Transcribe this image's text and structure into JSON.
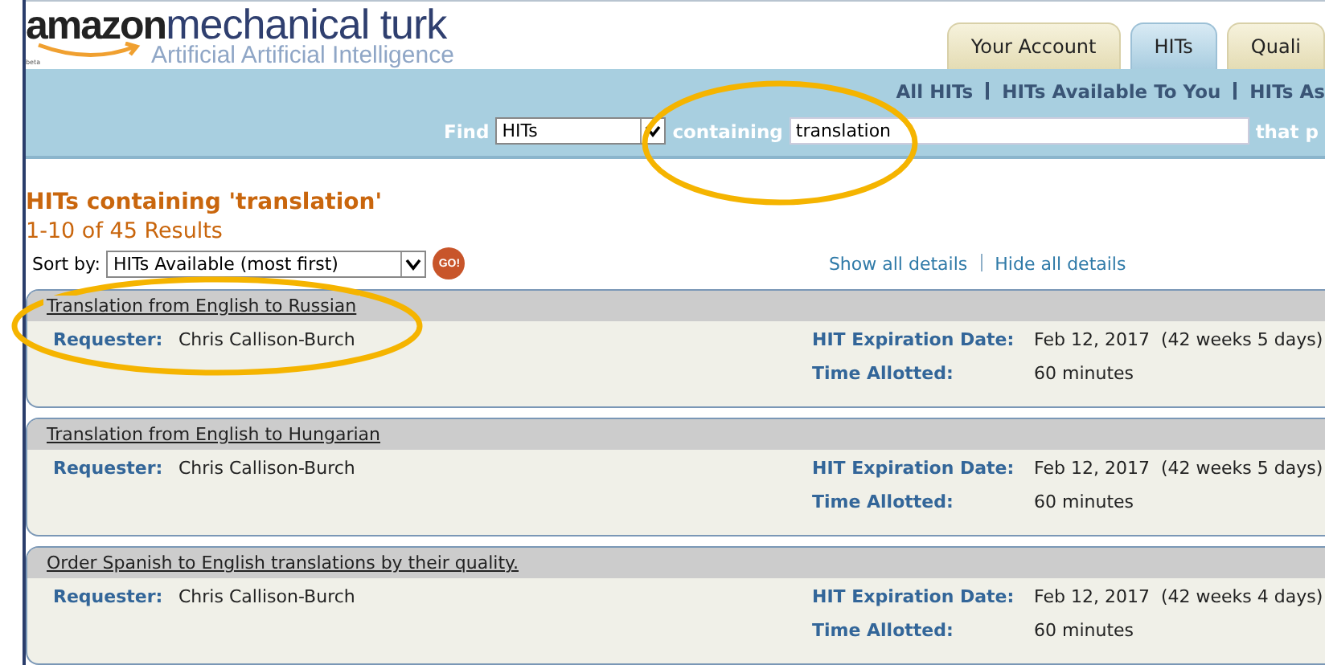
{
  "logo": {
    "brand": "amazon",
    "product": "mechanical turk",
    "tagline": "Artificial Artificial Intelligence",
    "badge": "beta"
  },
  "tabs": [
    {
      "label": "Your Account",
      "selected": false
    },
    {
      "label": "HITs",
      "selected": true
    },
    {
      "label": "Quali",
      "selected": false
    }
  ],
  "nav_links": [
    "All HITs",
    "HITs Available To You",
    "HITs As"
  ],
  "search": {
    "find_label": "Find",
    "type_value": "HITs",
    "containing_label": "containing",
    "query": "translation",
    "trailing_label": "that p"
  },
  "heading": "HITs containing 'translation'",
  "result_count": "1-10 of 45 Results",
  "sort": {
    "label": "Sort by:",
    "value": "HITs Available (most first)",
    "go": "GO!"
  },
  "detail_links": [
    "Show all details",
    "Hide all details"
  ],
  "hits": [
    {
      "title": "Translation from English to Russian",
      "requester_label": "Requester:",
      "requester": "Chris Callison-Burch",
      "expiration_label": "HIT Expiration Date:",
      "expiration": "Feb 12, 2017  (42 weeks 5 days)",
      "time_label": "Time Allotted:",
      "time": "60 minutes"
    },
    {
      "title": "Translation from English to Hungarian",
      "requester_label": "Requester:",
      "requester": "Chris Callison-Burch",
      "expiration_label": "HIT Expiration Date:",
      "expiration": "Feb 12, 2017  (42 weeks 5 days)",
      "time_label": "Time Allotted:",
      "time": "60 minutes"
    },
    {
      "title": "Order Spanish to English translations by their quality.",
      "requester_label": "Requester:",
      "requester": "Chris Callison-Burch",
      "expiration_label": "HIT Expiration Date:",
      "expiration": "Feb 12, 2017  (42 weeks 4 days)",
      "time_label": "Time Allotted:",
      "time": "60 minutes"
    }
  ]
}
